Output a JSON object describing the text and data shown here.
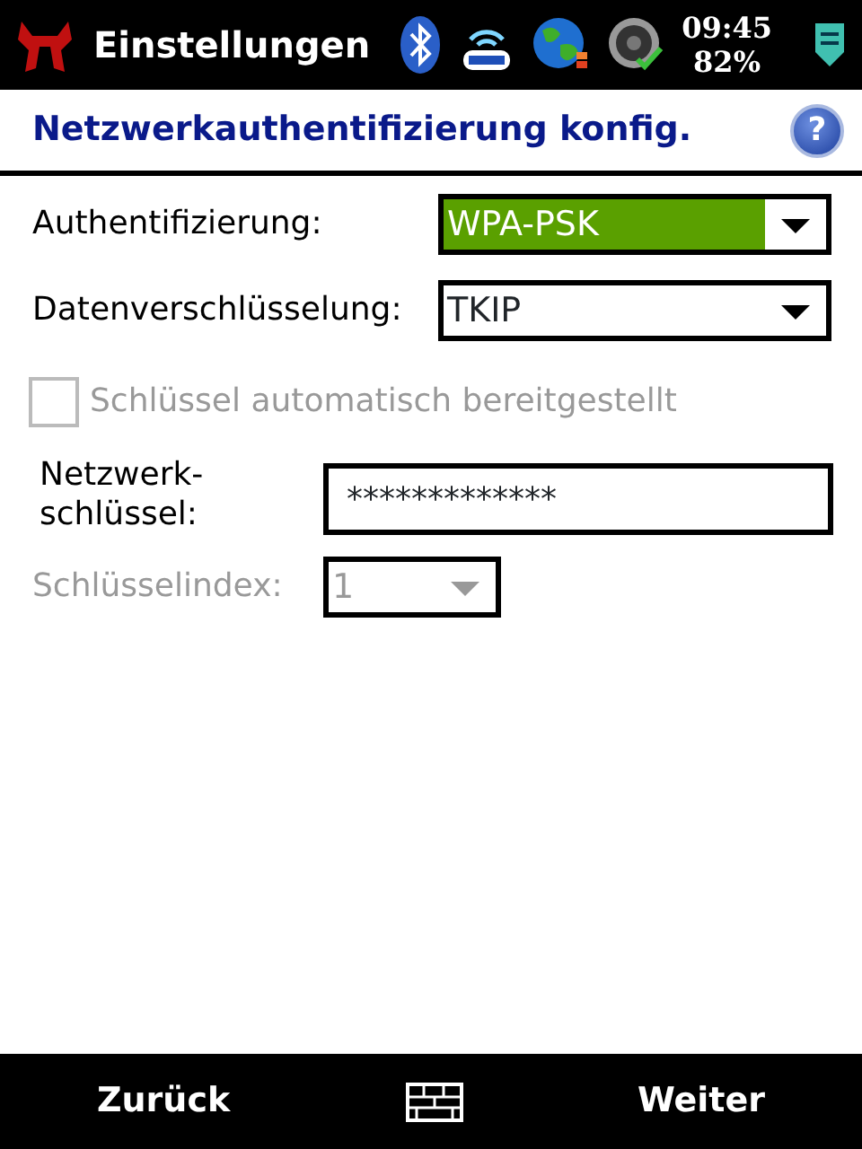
{
  "status_bar": {
    "title": "Einstellungen",
    "time": "09:45",
    "battery": "82%"
  },
  "header": {
    "title": "Netzwerkauthentifizierung konfig.",
    "help": "?"
  },
  "form": [
    {
      "kind": "select",
      "label": "Authentifizierung:",
      "value": "WPA-PSK",
      "focused": true,
      "disabled": false
    },
    {
      "kind": "select",
      "label": "Datenverschlüsselung:",
      "value": "TKIP",
      "focused": false,
      "disabled": false
    },
    {
      "kind": "checkbox",
      "label": "Schlüssel automatisch bereitgestellt",
      "checked": false,
      "disabled": true
    },
    {
      "kind": "password",
      "label": "Netzwerk-\nschlüssel:",
      "value": "*************"
    },
    {
      "kind": "select",
      "label": "Schlüsselindex:",
      "value": "1",
      "focused": false,
      "disabled": true
    }
  ],
  "softkeys": {
    "left": "Zurück",
    "right": "Weiter"
  }
}
